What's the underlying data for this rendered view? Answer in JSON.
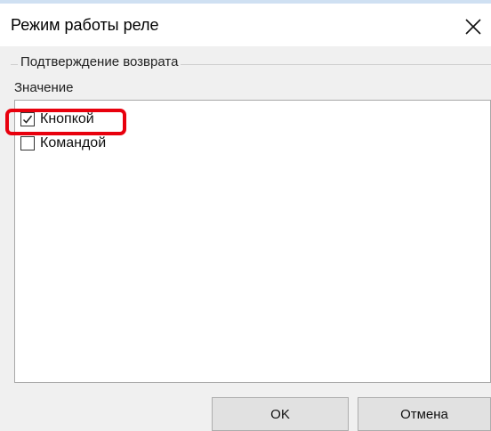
{
  "window": {
    "title": "Режим работы реле",
    "close_icon": "close-icon"
  },
  "group": {
    "title": "Подтверждение возврата",
    "field_label": "Значение"
  },
  "options": [
    {
      "label": "Кнопкой",
      "checked": true,
      "highlighted": true
    },
    {
      "label": "Командой",
      "checked": false,
      "highlighted": false
    }
  ],
  "buttons": {
    "ok": "OK",
    "cancel": "Отмена"
  },
  "colors": {
    "highlight": "#e8000d",
    "dialog_bg": "#f0f0f0",
    "button_bg": "#e1e1e1"
  }
}
